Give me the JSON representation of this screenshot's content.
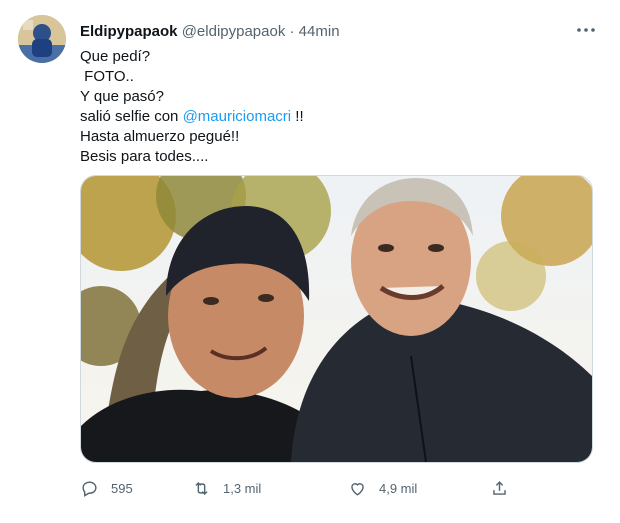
{
  "author": {
    "display_name": "Eldipypapaok",
    "handle": "@eldipypapaok",
    "time": " · 44min"
  },
  "tweet": {
    "lines": [
      "Que pedí?",
      " FOTO..",
      "Y que pasó?",
      "salió selfie con ",
      "Hasta almuerzo pegué!!",
      "Besis para todes...."
    ],
    "mention": "@mauriciomacri",
    "mention_suffix": " !!"
  },
  "actions": {
    "replies": "595",
    "retweets": "1,3 mil",
    "likes": "4,9 mil"
  },
  "colors": {
    "link": "#1d9bf0",
    "secondary_text": "#536471"
  },
  "icons": {
    "more": "more-horizontal-icon",
    "reply": "reply-icon",
    "retweet": "retweet-icon",
    "like": "heart-icon",
    "share": "share-icon"
  }
}
